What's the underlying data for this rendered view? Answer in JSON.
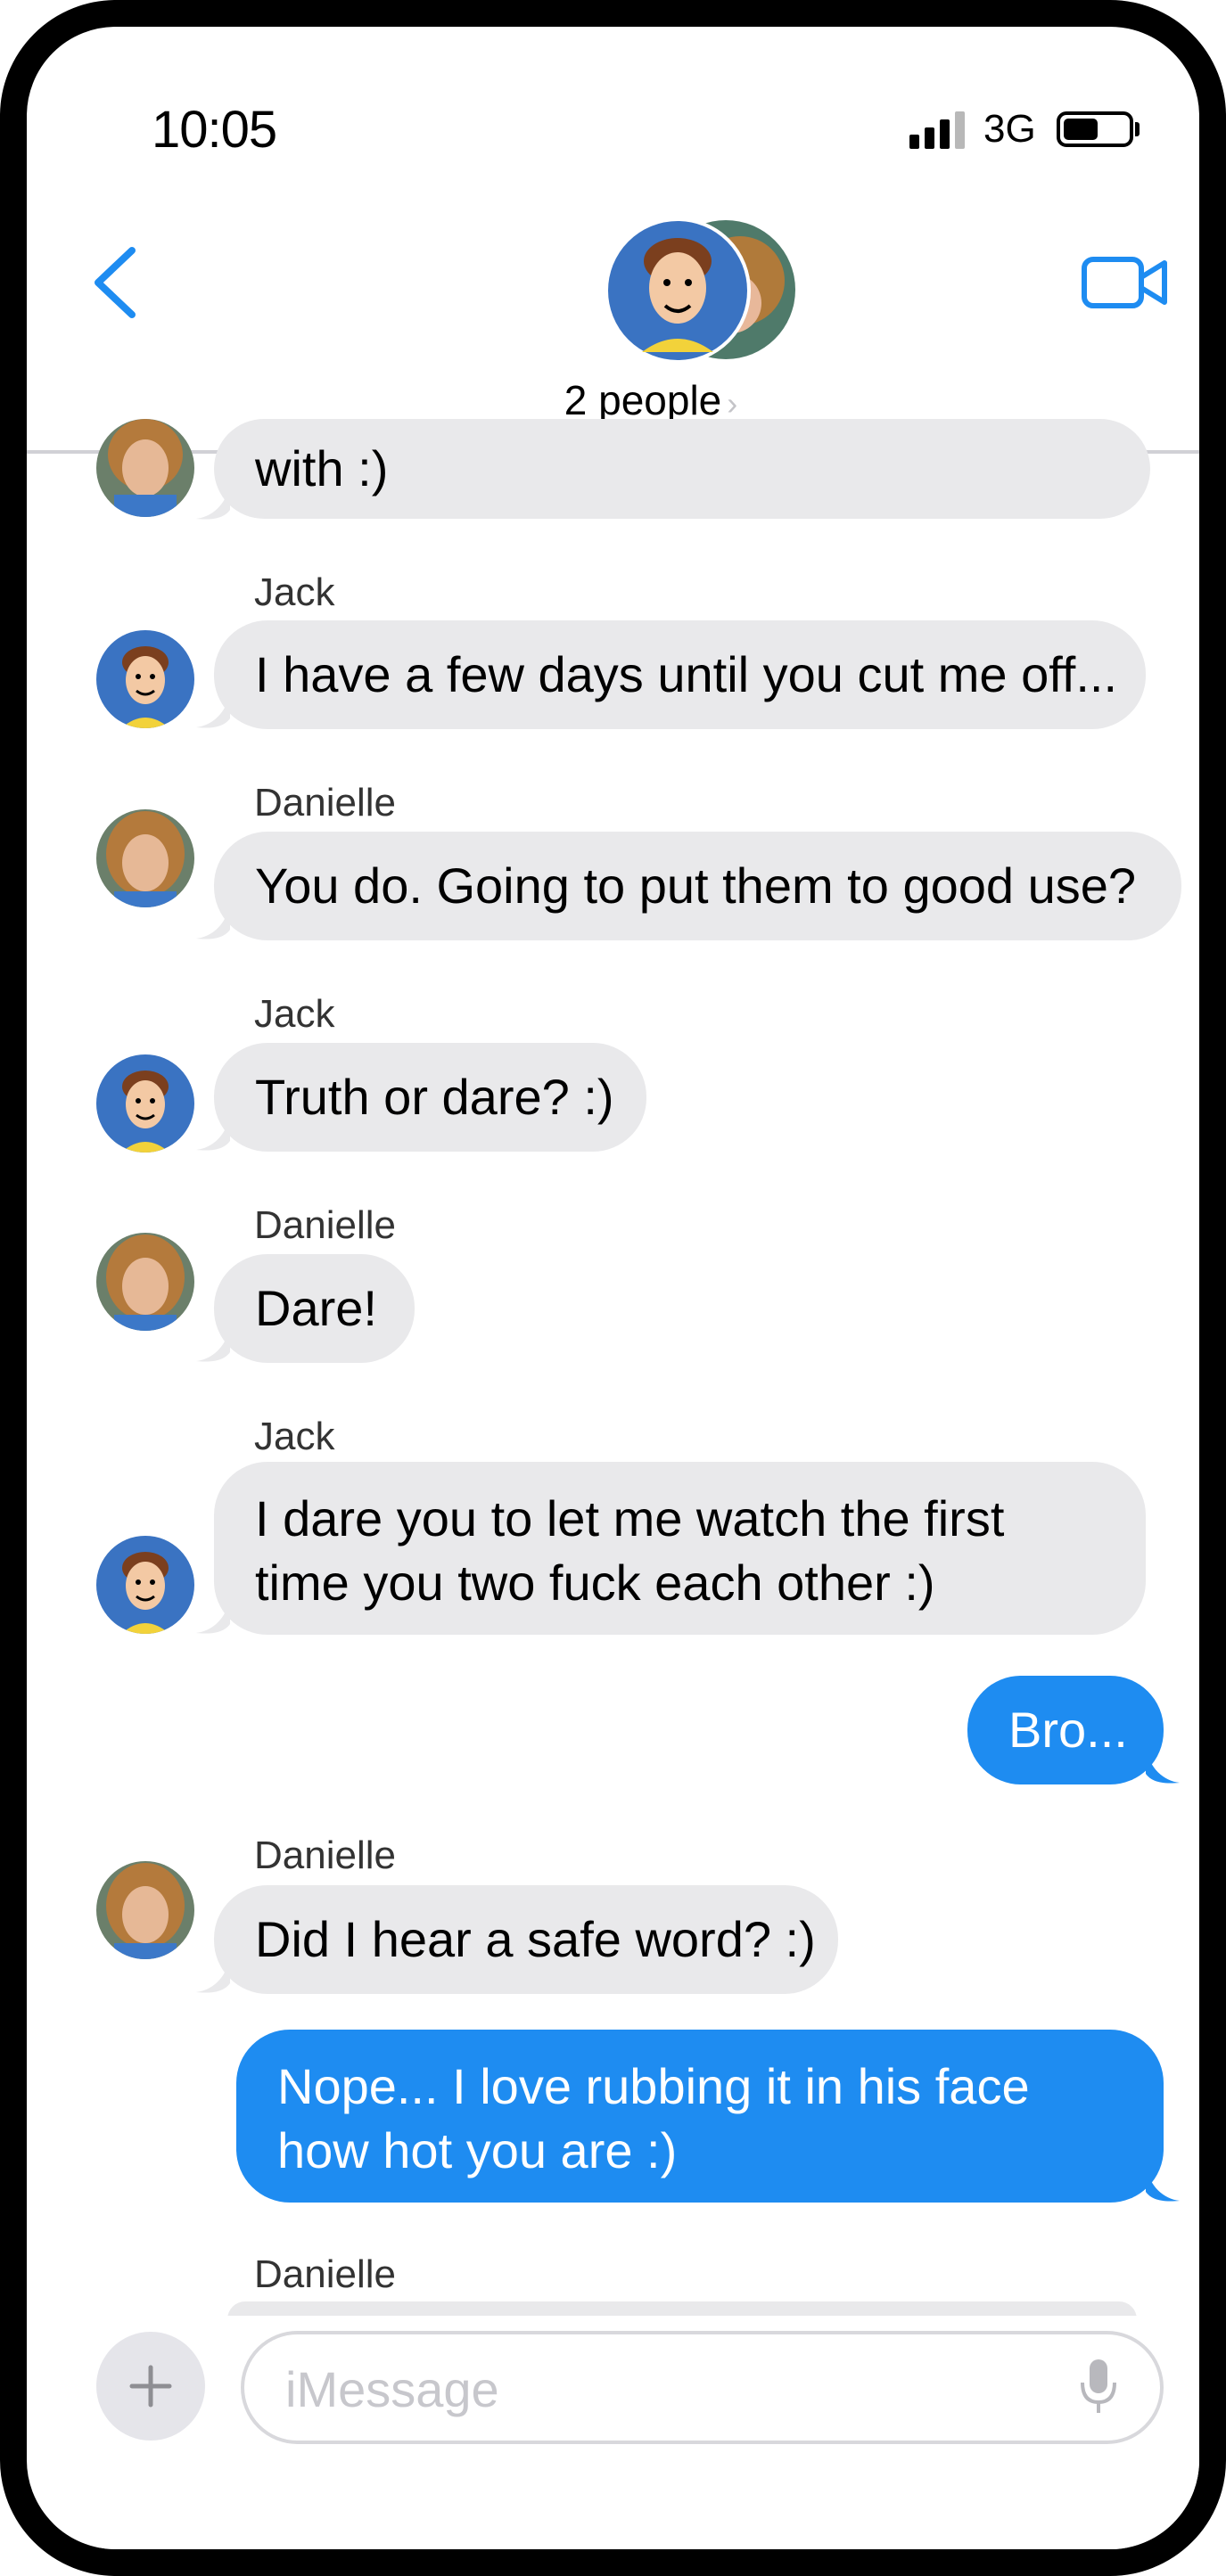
{
  "status": {
    "time": "10:05",
    "network": "3G"
  },
  "header": {
    "people_label": "2 people",
    "chevron": "›"
  },
  "messages": [
    {
      "sender": "",
      "text": "with :)",
      "type": "incoming",
      "avatar": "danielle"
    },
    {
      "sender": "Jack",
      "text": "I have a few days until you cut me off...",
      "type": "incoming",
      "avatar": "jack"
    },
    {
      "sender": "Danielle",
      "text": "You do.  Going to put them to good use?",
      "type": "incoming",
      "avatar": "danielle"
    },
    {
      "sender": "Jack",
      "text": "Truth or dare? :)",
      "type": "incoming",
      "avatar": "jack"
    },
    {
      "sender": "Danielle",
      "text": "Dare!",
      "type": "incoming",
      "avatar": "danielle"
    },
    {
      "sender": "Jack",
      "text": "I dare you to let me watch the first time you two fuck each other :)",
      "type": "incoming",
      "avatar": "jack"
    },
    {
      "sender": "",
      "text": "Bro...",
      "type": "outgoing"
    },
    {
      "sender": "Danielle",
      "text": "Did I hear a safe word? :)",
      "type": "incoming",
      "avatar": "danielle"
    },
    {
      "sender": "",
      "text": "Nope... I love rubbing it in his face how hot you are :)",
      "type": "outgoing"
    },
    {
      "sender": "Danielle",
      "text": "",
      "type": "incoming",
      "avatar": "danielle"
    }
  ],
  "composer": {
    "placeholder": "iMessage"
  },
  "icons": {
    "back": "chevron-left-icon",
    "video": "video-camera-icon",
    "plus": "plus-icon",
    "mic": "microphone-icon"
  },
  "colors": {
    "accent": "#1e8cf1",
    "incoming_bubble": "#e9e9eb",
    "outgoing_bubble": "#1e8cf1"
  }
}
